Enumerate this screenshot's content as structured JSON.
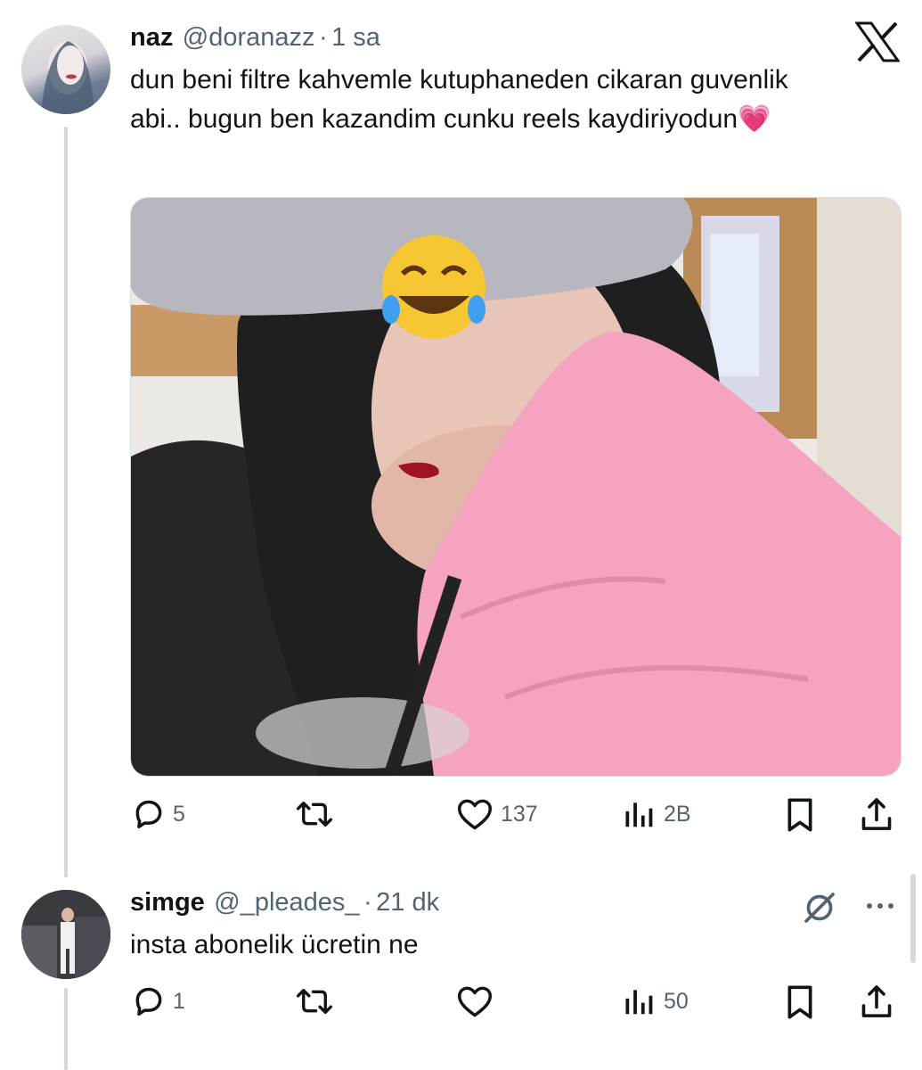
{
  "tweet1": {
    "name": "naz",
    "handle": "@doranazz",
    "separator": "·",
    "time": "1 sa",
    "text": "dun beni filtre kahvemle kutuphaneden cikaran guvenlik abi.. bugun ben kazandim cunku reels kaydiriyodun💗",
    "emoji_overlay": "😂",
    "stats": {
      "replies": "5",
      "likes": "137",
      "views": "2B"
    }
  },
  "tweet2": {
    "name": "simge",
    "handle": "@_pleades_",
    "separator": "·",
    "time": "21 dk",
    "text": "insta abonelik ücretin ne",
    "stats": {
      "replies": "1",
      "views": "50"
    }
  },
  "colors": {
    "text": "#0f1419",
    "secondary": "#536471",
    "line": "#cfd9de",
    "pink": "#f5a3c0"
  },
  "icons": [
    "x-logo-icon",
    "reply-icon",
    "retweet-icon",
    "like-icon",
    "views-icon",
    "bookmark-icon",
    "share-icon",
    "grok-slash-icon",
    "more-icon"
  ]
}
